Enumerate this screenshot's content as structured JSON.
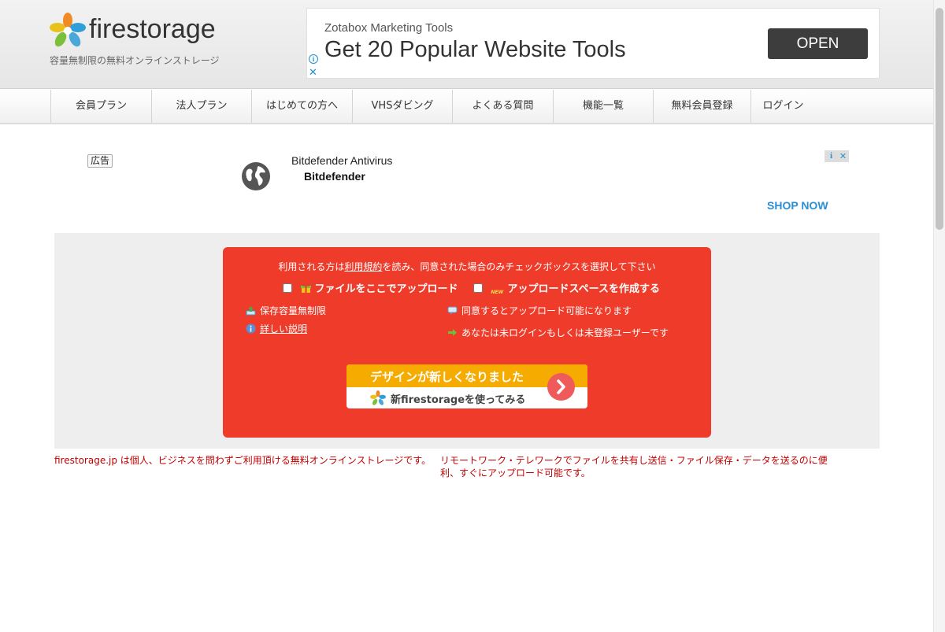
{
  "header": {
    "logo_text": "firestorage",
    "tagline": "容量無制限の無料オンラインストレージ"
  },
  "top_ad": {
    "brand": "Zotabox Marketing Tools",
    "headline": "Get 20 Popular Website Tools",
    "button": "OPEN",
    "choices_glyph": "i",
    "close_glyph": "✕"
  },
  "nav": {
    "items": [
      {
        "label": "会員プラン"
      },
      {
        "label": "法人プラン"
      },
      {
        "label": "はじめての方へ"
      },
      {
        "label": "VHSダビング"
      },
      {
        "label": "よくある質問"
      },
      {
        "label": "機能一覧"
      },
      {
        "label": "無料会員登録"
      },
      {
        "label": "ログイン"
      }
    ]
  },
  "mid_ad": {
    "badge": "広告",
    "title": "Bitdefender Antivirus",
    "advertiser": "Bitdefender",
    "cta": "SHOP NOW",
    "choices_glyph": "i",
    "close_glyph": "✕"
  },
  "upload": {
    "notice_pre": "利用される方は",
    "notice_link": "利用規約",
    "notice_post": "を読み、同意された場合のみチェックボックスを選択して下さい",
    "option_file": "ファイルをここでアップロード",
    "option_space": "アップロードスペースを作成する",
    "new_badge": "NEW",
    "info_unlimited": "保存容量無制限",
    "info_details": "詳しい説明",
    "info_agree": "同意するとアップロード可能になります",
    "info_login": "あなたは未ログインもしくは未登録ユーザーです",
    "banner_top": "デザインが新しくなりました",
    "banner_bottom": "新firestorageを使ってみる"
  },
  "description": {
    "left": "firestorage.jp は個人、ビジネスを問わずご利用頂ける無料オンラインストレージです。",
    "right": "リモートワーク・テレワークでファイルを共有し送信・ファイル保存・データを送るのに便利、すぐにアップロード可能です。"
  },
  "colors": {
    "upload_red": "#ef3b2a",
    "banner_orange": "#f6ab00",
    "link_blue": "#2a8fd4",
    "desc_red": "#c00000"
  }
}
